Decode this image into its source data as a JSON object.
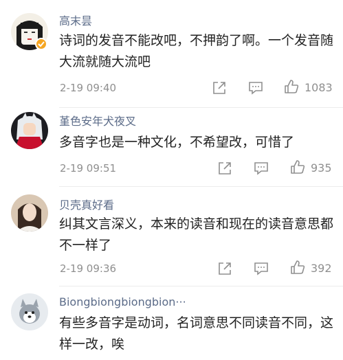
{
  "comments": [
    {
      "name": "高末昙",
      "text": "诗词的发音不能改吧，不押韵了啊。一个发音随大流就随大流吧",
      "time": "2-19 09:40",
      "likes": "1083"
    },
    {
      "name": "堇色安年犬夜叉",
      "text": "多音字也是一种文化，不希望改，可惜了",
      "time": "2-19 09:51",
      "likes": "935"
    },
    {
      "name": "贝壳真好看",
      "text": "纠其文言深义，本来的读音和现在的读音意思都不一样了",
      "time": "2-19 09:36",
      "likes": "392"
    },
    {
      "name": "Biongbiongbiongbion···",
      "text": "有些多音字是动词，名词意思不同读音不同，这样一改，唉"
    }
  ],
  "colors": {
    "name": "#5b6b88",
    "text": "#222222",
    "meta": "#8f8f8f",
    "badge": "#f5a623"
  },
  "icons": {
    "share": "share-icon",
    "comment": "comment-icon",
    "like": "thumbs-up-icon",
    "verified": "verified-badge-icon"
  }
}
